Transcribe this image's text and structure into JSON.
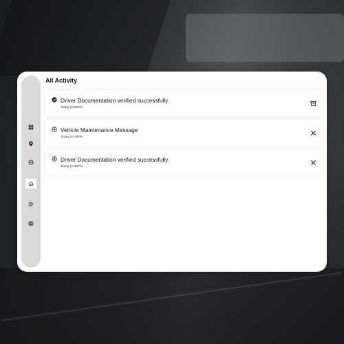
{
  "page": {
    "title": "All Activity"
  },
  "sidebar": {
    "items": [
      {
        "name": "dashboard",
        "icon": "grid-icon",
        "active": false
      },
      {
        "name": "location",
        "icon": "location-pin-icon",
        "active": false
      },
      {
        "name": "routes",
        "icon": "steering-icon",
        "active": false
      },
      {
        "name": "vehicles",
        "icon": "car-icon",
        "active": true
      },
      {
        "name": "drivers",
        "icon": "add-user-icon",
        "active": false
      },
      {
        "name": "settings",
        "icon": "target-icon",
        "active": false
      }
    ]
  },
  "activity": [
    {
      "icon": "check-circle-icon",
      "title": "Driver Documentation verified successfully",
      "time": "Today 10:30PM",
      "action": "archive-icon"
    },
    {
      "icon": "close-circle-icon",
      "title": "Vehicle Maintenance Message",
      "time": "Today 10:30PM",
      "action": "close-icon"
    },
    {
      "icon": "close-circle-icon",
      "title": "Driver Documentation verified successfully",
      "time": "Today 10:30PM",
      "action": "close-icon"
    }
  ]
}
